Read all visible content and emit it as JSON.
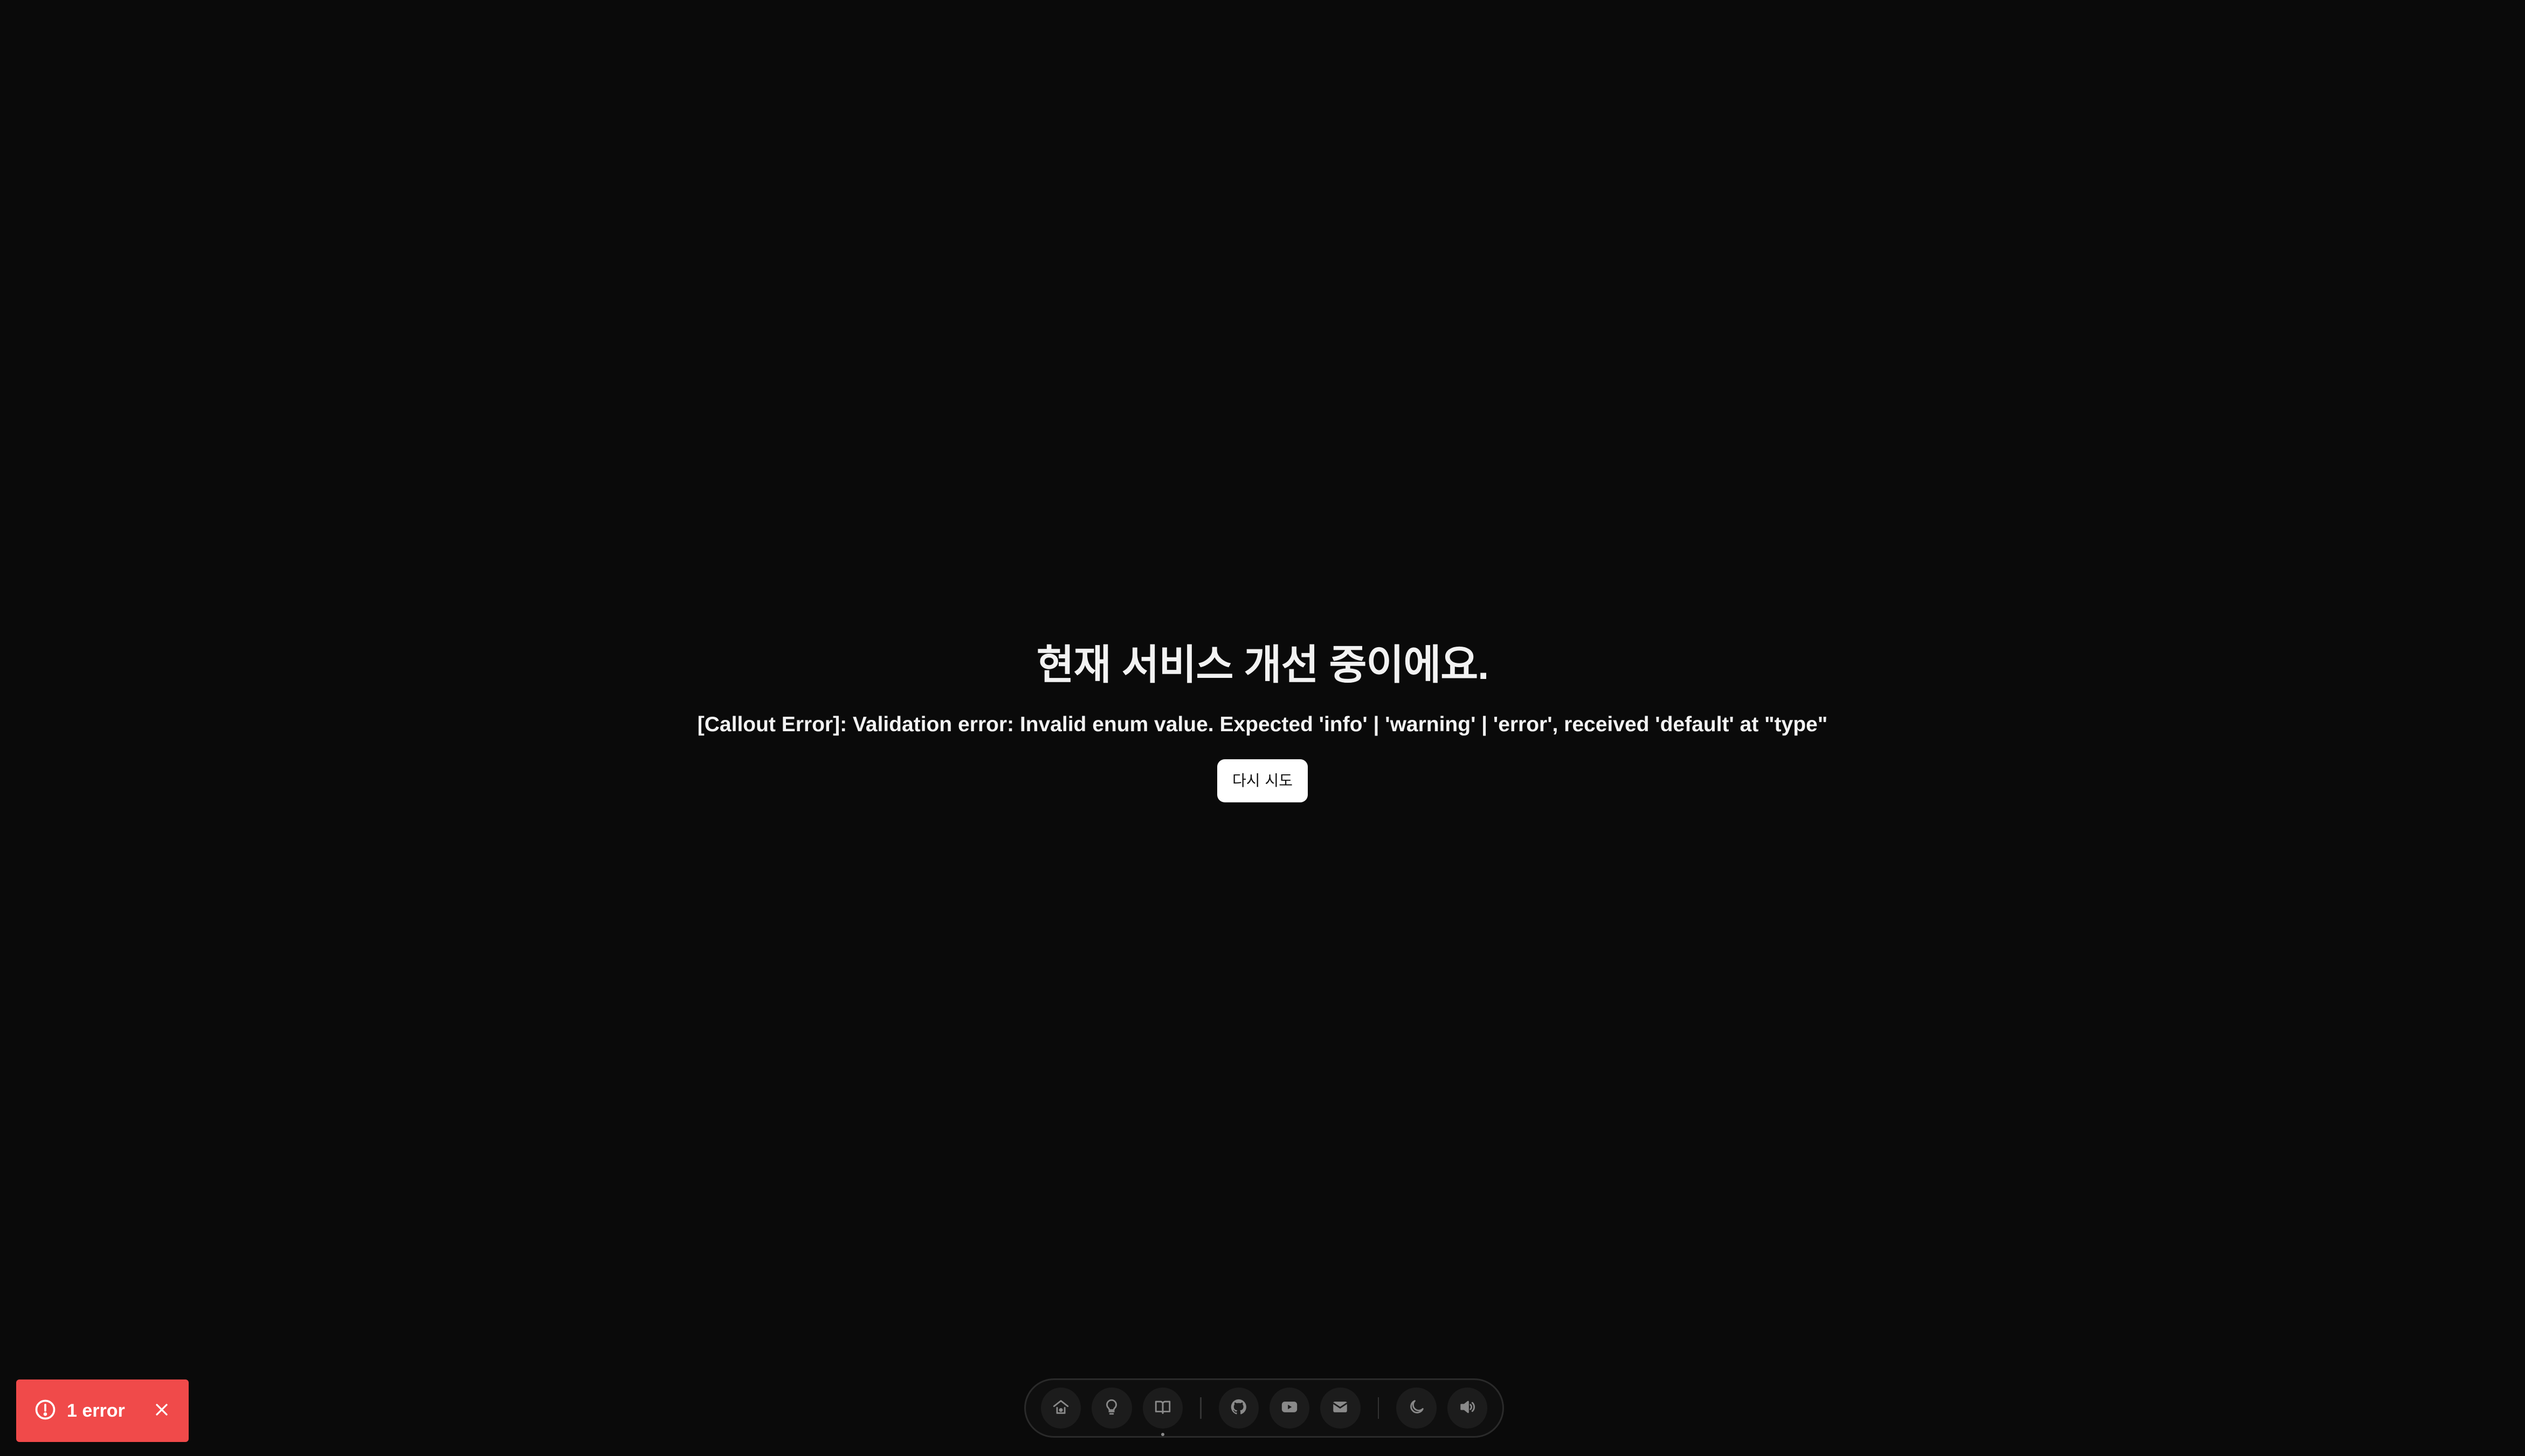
{
  "main": {
    "title": "현재 서비스 개선 중이에요.",
    "error_message": "[Callout Error]: Validation error: Invalid enum value. Expected 'info' | 'warning' | 'error', received 'default' at \"type\"",
    "retry_label": "다시 시도"
  },
  "dock": {
    "groups": [
      [
        "home-icon",
        "lightbulb-icon",
        "book-icon"
      ],
      [
        "github-icon",
        "youtube-icon",
        "mail-icon"
      ],
      [
        "moon-icon",
        "speaker-icon"
      ]
    ],
    "active": "book-icon"
  },
  "toast": {
    "count_label": "1 error",
    "color": "#f04a4a"
  },
  "colors": {
    "background": "#0a0a0a",
    "text": "#f2f2f2",
    "button_bg": "#ffffff"
  }
}
